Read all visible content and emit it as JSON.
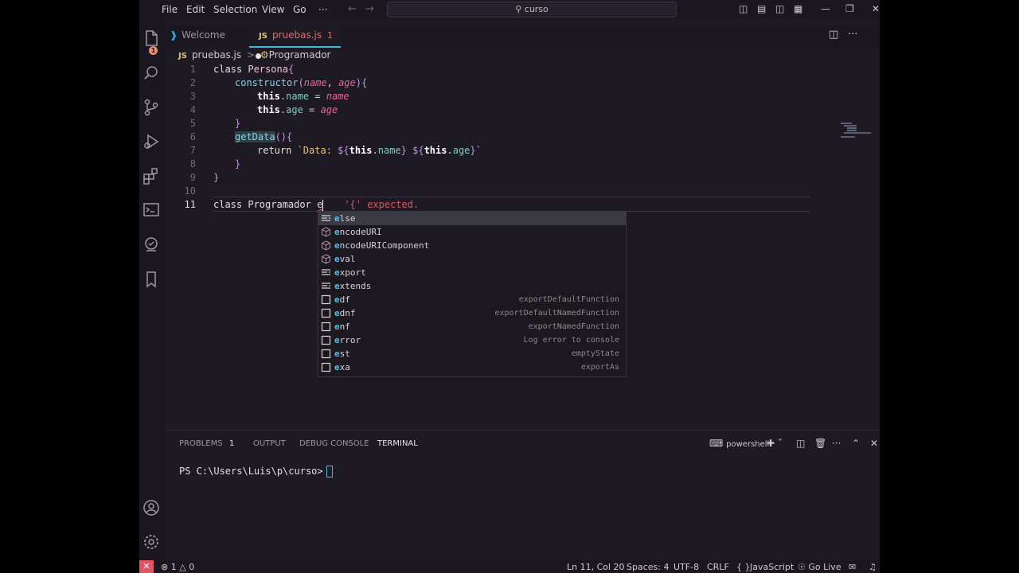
{
  "menu": [
    "File",
    "Edit",
    "Selection",
    "View",
    "Go",
    "···"
  ],
  "search": {
    "text": "curso"
  },
  "activity_badge": "1",
  "tabs": [
    {
      "label": "Welcome"
    },
    {
      "badge": "JS",
      "label": "pruebas.js",
      "count": "1"
    }
  ],
  "breadcrumb": {
    "badge": "JS",
    "file": "pruebas.js",
    "separator": ">",
    "symbol": "Programador"
  },
  "line_numbers": [
    "1",
    "2",
    "3",
    "4",
    "5",
    "6",
    "7",
    "8",
    "9",
    "10",
    "11"
  ],
  "code": {
    "l1": {
      "kw": "class",
      "name": "Persona",
      "brace": "{"
    },
    "l2": {
      "fn": "constructor",
      "open": "(",
      "p1": "name",
      "comma": ", ",
      "p2": "age",
      "close": "){"
    },
    "l3": {
      "this": "this",
      "dot": ".",
      "prop": "name",
      "eq": " = ",
      "val": "name"
    },
    "l4": {
      "this": "this",
      "dot": ".",
      "prop": "age",
      "eq": " = ",
      "val": "age"
    },
    "l5": {
      "brace": "}"
    },
    "l6": {
      "fn": "getData",
      "paren": "()",
      "brace": "{"
    },
    "l7": {
      "kw": "return",
      "s1": " `Data: ",
      "i1": "${",
      "t1": "this",
      "d1": ".",
      "p1": "name",
      "c1": "}",
      "sp": " ",
      "i2": "${",
      "t2": "this",
      "d2": ".",
      "p2": "age",
      "c2": "}",
      "end": "`"
    },
    "l8": {
      "brace": "}"
    },
    "l9": {
      "brace": "}"
    },
    "l11": {
      "kw": "class",
      "name": "Programador",
      "typed": "e",
      "error": "'{' expected."
    }
  },
  "suggestions": [
    {
      "match": "e",
      "rest": "lse",
      "detail": "",
      "kind": "keyword-icon"
    },
    {
      "match": "e",
      "rest": "ncodeURI",
      "detail": "",
      "kind": "method-cube-icon"
    },
    {
      "match": "e",
      "rest": "ncodeURIComponent",
      "detail": "",
      "kind": "method-cube-icon"
    },
    {
      "match": "e",
      "rest": "val",
      "detail": "",
      "kind": "method-cube-icon"
    },
    {
      "match": "e",
      "rest": "xport",
      "detail": "",
      "kind": "keyword-icon"
    },
    {
      "match": "e",
      "rest": "xtends",
      "detail": "",
      "kind": "keyword-icon"
    },
    {
      "match": "e",
      "rest": "df",
      "detail": "exportDefaultFunction",
      "kind": "snippet-square-icon"
    },
    {
      "match": "e",
      "rest": "dnf",
      "detail": "exportDefaultNamedFunction",
      "kind": "snippet-square-icon"
    },
    {
      "match": "e",
      "rest": "nf",
      "detail": "exportNamedFunction",
      "kind": "snippet-square-icon"
    },
    {
      "match": "e",
      "rest": "rror",
      "detail": "Log error to console",
      "kind": "snippet-square-icon"
    },
    {
      "match": "e",
      "rest": "st",
      "detail": "emptyState",
      "kind": "snippet-square-icon"
    },
    {
      "match": "e",
      "rest": "xa",
      "detail": "exportAs",
      "kind": "snippet-square-icon"
    }
  ],
  "panel": {
    "tabs": [
      "PROBLEMS",
      "OUTPUT",
      "DEBUG CONSOLE",
      "TERMINAL"
    ],
    "problems_count": "1",
    "shell": "powershell",
    "prompt": "PS C:\\Users\\Luis\\p\\curso>"
  },
  "status": {
    "errors": "1",
    "warnings": "0",
    "position": "Ln 11, Col 20",
    "spaces": "Spaces: 4",
    "encoding": "UTF-8",
    "eol": "CRLF",
    "braces": "{ }",
    "language": "JavaScript",
    "golive": "Go Live"
  },
  "colors": {
    "accent": "#4fb3d9",
    "error": "#e05561",
    "background": "#1e1a24"
  }
}
